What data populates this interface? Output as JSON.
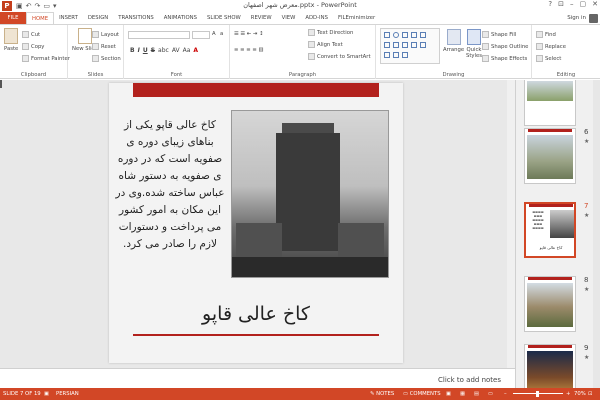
{
  "window": {
    "title": "معرض شهر اصفهان.pptx - PowerPoint",
    "app_icon": "P",
    "controls": [
      "?",
      "–",
      "▢",
      "✕"
    ]
  },
  "tabs": {
    "file": "FILE",
    "items": [
      "HOME",
      "INSERT",
      "DESIGN",
      "TRANSITIONS",
      "ANIMATIONS",
      "SLIDE SHOW",
      "REVIEW",
      "VIEW",
      "ADD-INS",
      "FILEminimizer"
    ],
    "active": "HOME",
    "sign_in": "Sign in"
  },
  "ribbon": {
    "clipboard": {
      "label": "Clipboard",
      "paste": "Paste",
      "cut": "Cut",
      "copy": "Copy",
      "format_painter": "Format Painter"
    },
    "slides": {
      "label": "Slides",
      "new_slide": "New Slide",
      "layout": "Layout",
      "reset": "Reset",
      "section": "Section"
    },
    "font": {
      "label": "Font",
      "bold": "B",
      "italic": "I",
      "underline": "U",
      "strike": "S",
      "shadow": "abc",
      "spacing": "AV",
      "case": "Aa",
      "color": "A"
    },
    "paragraph": {
      "label": "Paragraph",
      "text_direction": "Text Direction",
      "align_text": "Align Text",
      "convert_smartart": "Convert to SmartArt"
    },
    "drawing": {
      "label": "Drawing",
      "arrange": "Arrange",
      "quick_styles": "Quick Styles",
      "shape_fill": "Shape Fill",
      "shape_outline": "Shape Outline",
      "shape_effects": "Shape Effects"
    },
    "editing": {
      "label": "Editing",
      "find": "Find",
      "replace": "Replace",
      "select": "Select"
    }
  },
  "slide": {
    "body_text": "کاخ عالی قاپو یکی از بناهای زیبای دوره ی صفویه است که در دوره ی صفویه به دستور شاه عباس ساخته شده.وی در این مکان به امور کشور می پرداخت و دستورات لازم را صادر می کرد.",
    "title": "کاخ عالی قاپو",
    "accent_color": "#b2211d"
  },
  "notes": {
    "placeholder": "Click to add notes"
  },
  "thumbnails": [
    {
      "num": "",
      "star": ""
    },
    {
      "num": "6",
      "star": "★"
    },
    {
      "num": "7",
      "star": "★",
      "caption": "کاخ عالی قاپو"
    },
    {
      "num": "8",
      "star": "★"
    },
    {
      "num": "9",
      "star": "★"
    }
  ],
  "status": {
    "slide_of": "SLIDE 7 OF 19",
    "language": "PERSIAN",
    "notes": "NOTES",
    "comments": "COMMENTS",
    "zoom": "70%"
  },
  "colors": {
    "brand": "#d24726"
  }
}
